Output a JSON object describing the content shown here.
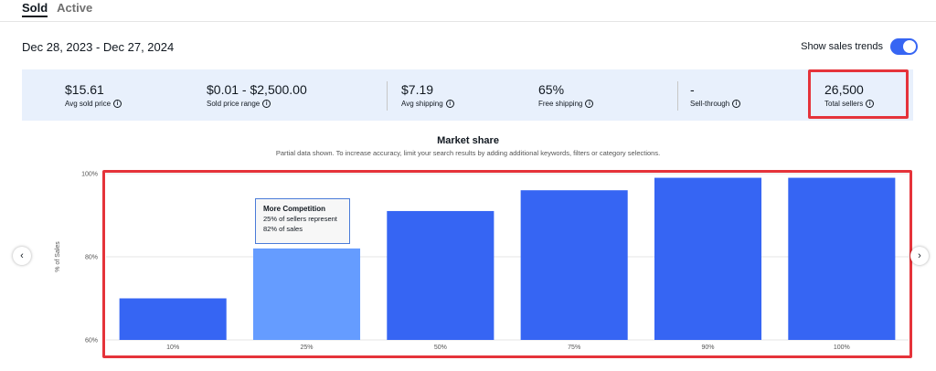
{
  "tabs": [
    {
      "label": "Sold",
      "active": true
    },
    {
      "label": "Active",
      "active": false
    }
  ],
  "header": {
    "date_range": "Dec 28, 2023 - Dec 27, 2024",
    "trend_label": "Show sales trends",
    "trend_enabled": true
  },
  "stats": [
    {
      "value": "$15.61",
      "label": "Avg sold price"
    },
    {
      "value": "$0.01 - $2,500.00",
      "label": "Sold price range"
    },
    {
      "value": "$7.19",
      "label": "Avg shipping"
    },
    {
      "value": "65%",
      "label": "Free shipping"
    },
    {
      "value": "-",
      "label": "Sell-through"
    },
    {
      "value": "26,500",
      "label": "Total sellers"
    }
  ],
  "market_share": {
    "title": "Market share",
    "subtitle": "Partial data shown. To increase accuracy, limit your search results by adding additional keywords, filters or category selections.",
    "tooltip": {
      "title": "More Competition",
      "line1": "25% of sellers represent",
      "line2": "82% of sales"
    }
  },
  "colors": {
    "accent": "#3665f3",
    "bar": "#3665f3",
    "bar_highlight": "#659cff",
    "stats_bg": "#e8f0fc",
    "annotation": "#e5333a"
  },
  "icons": {
    "info": "info-icon",
    "prev": "chevron-left-icon",
    "next": "chevron-right-icon"
  },
  "chart_data": {
    "type": "bar",
    "categories": [
      "10%",
      "25%",
      "50%",
      "75%",
      "90%",
      "100%"
    ],
    "values": [
      70,
      82,
      91,
      96,
      99,
      99
    ],
    "highlight_index": 1,
    "ylabel": "% of Sales",
    "xlabel": "",
    "ylim": [
      60,
      100
    ],
    "yticks": [
      60,
      80,
      100
    ],
    "ytick_labels": [
      "60%",
      "80%",
      "100%"
    ],
    "grid": true
  }
}
